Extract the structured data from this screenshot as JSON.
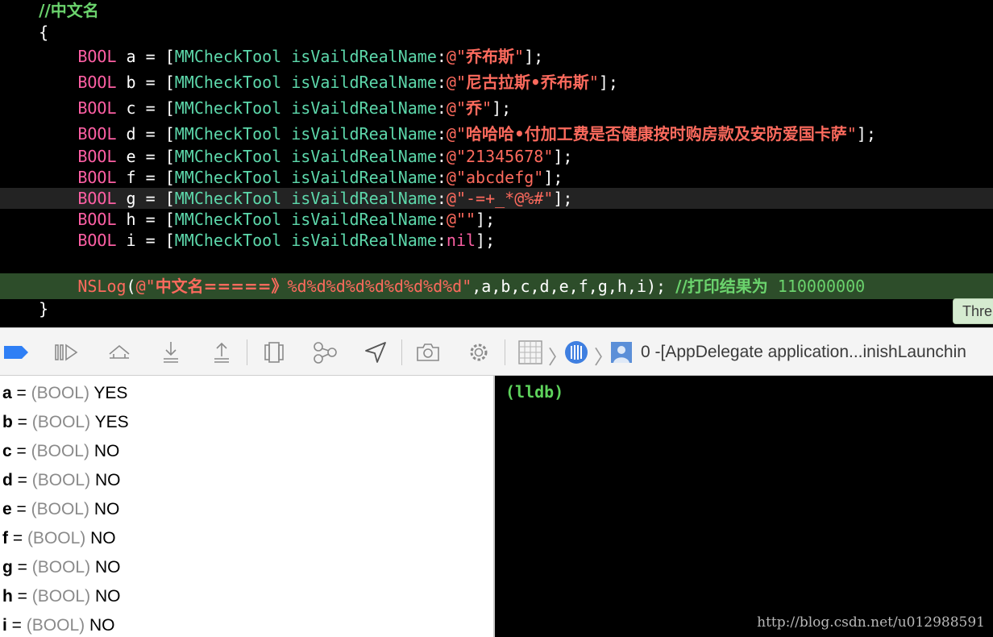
{
  "editor": {
    "lines": [
      {
        "indent": "    ",
        "tokens": [
          {
            "t": "//中文名",
            "c": "t-com-cn"
          }
        ]
      },
      {
        "indent": "    ",
        "tokens": [
          {
            "t": "{",
            "c": "t-plain"
          }
        ]
      },
      {
        "indent": "        ",
        "tokens": [
          {
            "t": "BOOL",
            "c": "t-kw"
          },
          {
            "t": " a = [",
            "c": "t-plain"
          },
          {
            "t": "MMCheckTool",
            "c": "t-cls"
          },
          {
            "t": " ",
            "c": "t-plain"
          },
          {
            "t": "isVaildRealName",
            "c": "t-meth"
          },
          {
            "t": ":",
            "c": "t-plain"
          },
          {
            "t": "@\"",
            "c": "t-str"
          },
          {
            "t": "乔布斯",
            "c": "t-str-cn"
          },
          {
            "t": "\"",
            "c": "t-str"
          },
          {
            "t": "];",
            "c": "t-plain"
          }
        ]
      },
      {
        "indent": "        ",
        "tokens": [
          {
            "t": "BOOL",
            "c": "t-kw"
          },
          {
            "t": " b = [",
            "c": "t-plain"
          },
          {
            "t": "MMCheckTool",
            "c": "t-cls"
          },
          {
            "t": " ",
            "c": "t-plain"
          },
          {
            "t": "isVaildRealName",
            "c": "t-meth"
          },
          {
            "t": ":",
            "c": "t-plain"
          },
          {
            "t": "@\"",
            "c": "t-str"
          },
          {
            "t": "尼古拉斯•乔布斯",
            "c": "t-str-cn"
          },
          {
            "t": "\"",
            "c": "t-str"
          },
          {
            "t": "];",
            "c": "t-plain"
          }
        ]
      },
      {
        "indent": "        ",
        "tokens": [
          {
            "t": "BOOL",
            "c": "t-kw"
          },
          {
            "t": " c = [",
            "c": "t-plain"
          },
          {
            "t": "MMCheckTool",
            "c": "t-cls"
          },
          {
            "t": " ",
            "c": "t-plain"
          },
          {
            "t": "isVaildRealName",
            "c": "t-meth"
          },
          {
            "t": ":",
            "c": "t-plain"
          },
          {
            "t": "@\"",
            "c": "t-str"
          },
          {
            "t": "乔",
            "c": "t-str-cn"
          },
          {
            "t": "\"",
            "c": "t-str"
          },
          {
            "t": "];",
            "c": "t-plain"
          }
        ]
      },
      {
        "indent": "        ",
        "tokens": [
          {
            "t": "BOOL",
            "c": "t-kw"
          },
          {
            "t": " d = [",
            "c": "t-plain"
          },
          {
            "t": "MMCheckTool",
            "c": "t-cls"
          },
          {
            "t": " ",
            "c": "t-plain"
          },
          {
            "t": "isVaildRealName",
            "c": "t-meth"
          },
          {
            "t": ":",
            "c": "t-plain"
          },
          {
            "t": "@\"",
            "c": "t-str"
          },
          {
            "t": "哈哈哈•付加工费是否健康按时购房款及安防爱国卡萨",
            "c": "t-str-cn"
          },
          {
            "t": "\"",
            "c": "t-str"
          },
          {
            "t": "];",
            "c": "t-plain"
          }
        ]
      },
      {
        "indent": "        ",
        "tokens": [
          {
            "t": "BOOL",
            "c": "t-kw"
          },
          {
            "t": " e = [",
            "c": "t-plain"
          },
          {
            "t": "MMCheckTool",
            "c": "t-cls"
          },
          {
            "t": " ",
            "c": "t-plain"
          },
          {
            "t": "isVaildRealName",
            "c": "t-meth"
          },
          {
            "t": ":",
            "c": "t-plain"
          },
          {
            "t": "@\"21345678\"",
            "c": "t-str"
          },
          {
            "t": "];",
            "c": "t-plain"
          }
        ]
      },
      {
        "indent": "        ",
        "tokens": [
          {
            "t": "BOOL",
            "c": "t-kw"
          },
          {
            "t": " f = [",
            "c": "t-plain"
          },
          {
            "t": "MMCheckTool",
            "c": "t-cls"
          },
          {
            "t": " ",
            "c": "t-plain"
          },
          {
            "t": "isVaildRealName",
            "c": "t-meth"
          },
          {
            "t": ":",
            "c": "t-plain"
          },
          {
            "t": "@\"abcdefg\"",
            "c": "t-str"
          },
          {
            "t": "];",
            "c": "t-plain"
          }
        ]
      },
      {
        "indent": "        ",
        "tokens": [
          {
            "t": "BOOL",
            "c": "t-kw"
          },
          {
            "t": " g = [",
            "c": "t-plain"
          },
          {
            "t": "MMCheckTool",
            "c": "t-cls"
          },
          {
            "t": " ",
            "c": "t-plain"
          },
          {
            "t": "isVaildRealName",
            "c": "t-meth"
          },
          {
            "t": ":",
            "c": "t-plain"
          },
          {
            "t": "@\"-=+_*@%#\"",
            "c": "t-str"
          },
          {
            "t": "];",
            "c": "t-plain"
          }
        ],
        "current": true
      },
      {
        "indent": "        ",
        "tokens": [
          {
            "t": "BOOL",
            "c": "t-kw"
          },
          {
            "t": " h = [",
            "c": "t-plain"
          },
          {
            "t": "MMCheckTool",
            "c": "t-cls"
          },
          {
            "t": " ",
            "c": "t-plain"
          },
          {
            "t": "isVaildRealName",
            "c": "t-meth"
          },
          {
            "t": ":",
            "c": "t-plain"
          },
          {
            "t": "@\"\"",
            "c": "t-str"
          },
          {
            "t": "];",
            "c": "t-plain"
          }
        ]
      },
      {
        "indent": "        ",
        "tokens": [
          {
            "t": "BOOL",
            "c": "t-kw"
          },
          {
            "t": " i = [",
            "c": "t-plain"
          },
          {
            "t": "MMCheckTool",
            "c": "t-cls"
          },
          {
            "t": " ",
            "c": "t-plain"
          },
          {
            "t": "isVaildRealName",
            "c": "t-meth"
          },
          {
            "t": ":",
            "c": "t-plain"
          },
          {
            "t": "nil",
            "c": "t-nil"
          },
          {
            "t": "];",
            "c": "t-plain"
          }
        ]
      },
      {
        "indent": "",
        "tokens": []
      },
      {
        "indent": "        ",
        "tokens": [
          {
            "t": "NSLog",
            "c": "t-fn"
          },
          {
            "t": "(",
            "c": "t-plain"
          },
          {
            "t": "@\"",
            "c": "t-str"
          },
          {
            "t": "中文名=====》",
            "c": "t-str-cn"
          },
          {
            "t": "%d%d%d%d%d%d%d%d%d\"",
            "c": "t-str"
          },
          {
            "t": ",a,b,c,d,e,f,g,h,i); ",
            "c": "t-plain"
          },
          {
            "t": "//打印结果为",
            "c": "t-com-cn"
          },
          {
            "t": " 110000000",
            "c": "t-com"
          }
        ],
        "highlight": true
      },
      {
        "indent": "    ",
        "tokens": [
          {
            "t": "}",
            "c": "t-plain"
          }
        ]
      }
    ],
    "thread_badge": "Thre"
  },
  "debug_bar": {
    "frame_label": "0 -[AppDelegate application...inishLaunchin",
    "buttons": [
      {
        "name": "breakpoints-toggle-button",
        "icon": "breakpoint-icon"
      },
      {
        "name": "continue-button",
        "icon": "continue-icon"
      },
      {
        "name": "step-over-button",
        "icon": "step-over-icon"
      },
      {
        "name": "step-into-button",
        "icon": "step-into-icon"
      },
      {
        "name": "step-out-button",
        "icon": "step-out-icon"
      },
      {
        "name": "debug-view-hierarchy-button",
        "icon": "view-hierarchy-icon"
      },
      {
        "name": "memory-graph-button",
        "icon": "memory-graph-icon"
      },
      {
        "name": "simulate-location-button",
        "icon": "location-arrow-icon"
      },
      {
        "name": "capture-gpu-frame-button",
        "icon": "camera-icon"
      },
      {
        "name": "environment-overrides-button",
        "icon": "gear-icon"
      }
    ]
  },
  "variables": [
    {
      "name": "a",
      "eq": " = ",
      "type": "(BOOL)",
      "value": "YES"
    },
    {
      "name": "b",
      "eq": " = ",
      "type": "(BOOL)",
      "value": "YES"
    },
    {
      "name": "c",
      "eq": " = ",
      "type": "(BOOL)",
      "value": "NO"
    },
    {
      "name": "d",
      "eq": " = ",
      "type": "(BOOL)",
      "value": "NO"
    },
    {
      "name": "e",
      "eq": " = ",
      "type": "(BOOL)",
      "value": "NO"
    },
    {
      "name": "f",
      "eq": " = ",
      "type": "(BOOL)",
      "value": "NO"
    },
    {
      "name": "g",
      "eq": " = ",
      "type": "(BOOL)",
      "value": "NO"
    },
    {
      "name": "h",
      "eq": " = ",
      "type": "(BOOL)",
      "value": "NO"
    },
    {
      "name": "i",
      "eq": " = ",
      "type": "(BOOL)",
      "value": "NO"
    }
  ],
  "console": {
    "prompt": "(lldb)",
    "watermark": "http://blog.csdn.net/u012988591"
  },
  "colors": {
    "keyword": "#fc5fa3",
    "class": "#5dd8ab",
    "string": "#fc6a5d",
    "comment": "#6bd36d",
    "highlight_line": "#2d4d2a",
    "breakpoint": "#2f7ff5"
  }
}
